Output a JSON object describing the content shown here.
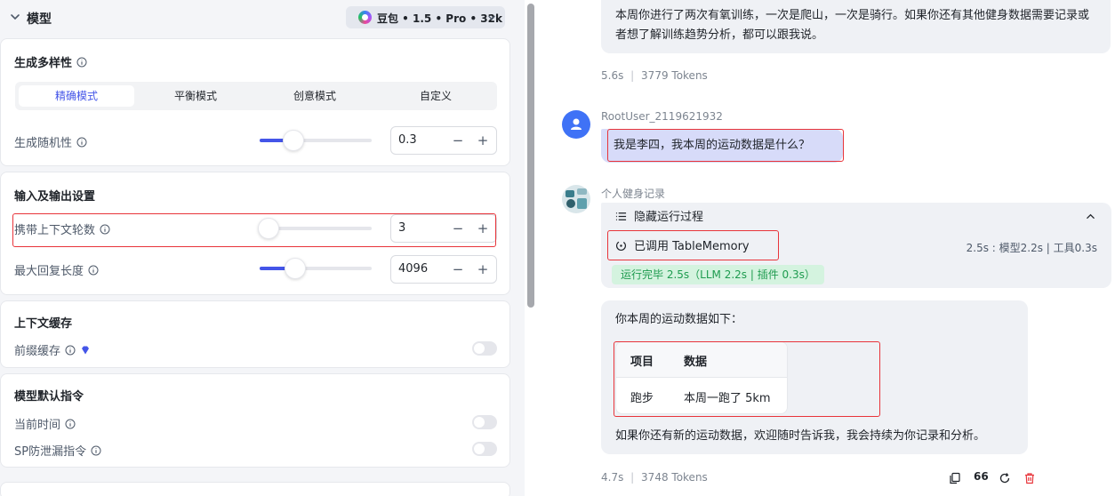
{
  "model_section": {
    "title": "模型",
    "model_name": "豆包 • 1.5 • Pro • 32k"
  },
  "diversity": {
    "title": "生成多样性",
    "modes": [
      "精确模式",
      "平衡模式",
      "创意模式",
      "自定义"
    ],
    "active_mode": "精确模式",
    "randomness_label": "生成随机性",
    "randomness_value": "0.3",
    "randomness_fraction": 0.3
  },
  "io_settings": {
    "title": "输入及输出设置",
    "context_rounds_label": "携带上下文轮数",
    "context_rounds_value": "3",
    "context_rounds_fraction": 0.02,
    "max_reply_label": "最大回复长度",
    "max_reply_value": "4096",
    "max_reply_fraction": 0.32
  },
  "context_cache": {
    "title": "上下文缓存",
    "prefix_cache_label": "前缀缓存",
    "prefix_cache_on": false
  },
  "default_instructions": {
    "title": "模型默认指令",
    "current_time_label": "当前时间",
    "current_time_on": false,
    "sp_leak_label": "SP防泄漏指令",
    "sp_leak_on": false
  },
  "stepper_buttons": {
    "minus": "−",
    "plus": "+"
  },
  "chat": {
    "prev_reply": "本周你进行了两次有氧训练，一次是爬山，一次是骑行。如果你还有其他健身数据需要记录或者想了解训练趋势分析，都可以跟我说。",
    "prev_meta_time": "5.6s",
    "prev_meta_tokens": "3779 Tokens",
    "user_name": "RootUser_2119621932",
    "user_message": "我是李四，我本周的运动数据是什么？",
    "bot_name": "个人健身记录",
    "run_toggle_label": "隐藏运行过程",
    "tool_call_label": "已调用 TableMemory",
    "tool_timing": "2.5s : 模型2.2s | 工具0.3s",
    "run_status": "运行完毕 2.5s（LLM 2.2s | 插件 0.3s）",
    "reply_intro": "你本周的运动数据如下：",
    "table_headers": [
      "项目",
      "数据"
    ],
    "table_rows": [
      [
        "跑步",
        "本周一跑了 5km"
      ]
    ],
    "reply_outro": "如果你还有新的运动数据，欢迎随时告诉我，我会持续为你记录和分析。",
    "last_meta_time": "4.7s",
    "last_meta_tokens": "3748 Tokens",
    "quote_count": "66"
  },
  "colors": {
    "accent": "#4455e8",
    "highlight_border": "#e8343a",
    "success_bg": "#d4f3df",
    "success_text": "#1e9b4f",
    "delete": "#e8343a",
    "user_avatar": "#3f72f6"
  }
}
